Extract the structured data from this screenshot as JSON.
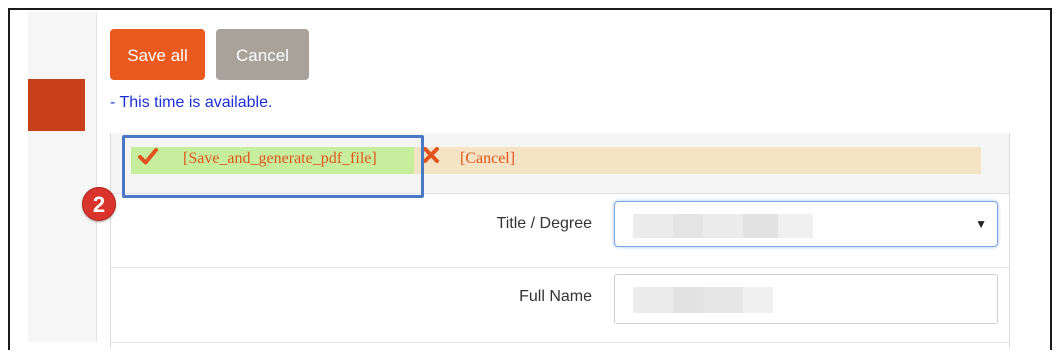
{
  "toolbar": {
    "save_all_label": "Save all",
    "cancel_label": "Cancel"
  },
  "status": {
    "availability_text": "- This time is available."
  },
  "action_bar": {
    "save_pdf_label": "[Save_and_generate_pdf_file]",
    "cancel_label": "[Cancel]",
    "check_icon": "check-icon",
    "close_icon": "x-icon"
  },
  "annotation": {
    "step_number": "2"
  },
  "form": {
    "title_degree_label": "Title / Degree",
    "title_degree_value": "",
    "full_name_label": "Full Name",
    "full_name_value": ""
  },
  "colors": {
    "accent_orange": "#ea5a1e",
    "cancel_gray": "#a8a29b",
    "availability_blue": "#1c2fd6",
    "highlight_blue": "#4a78c4",
    "marker_red": "#d9342b"
  }
}
